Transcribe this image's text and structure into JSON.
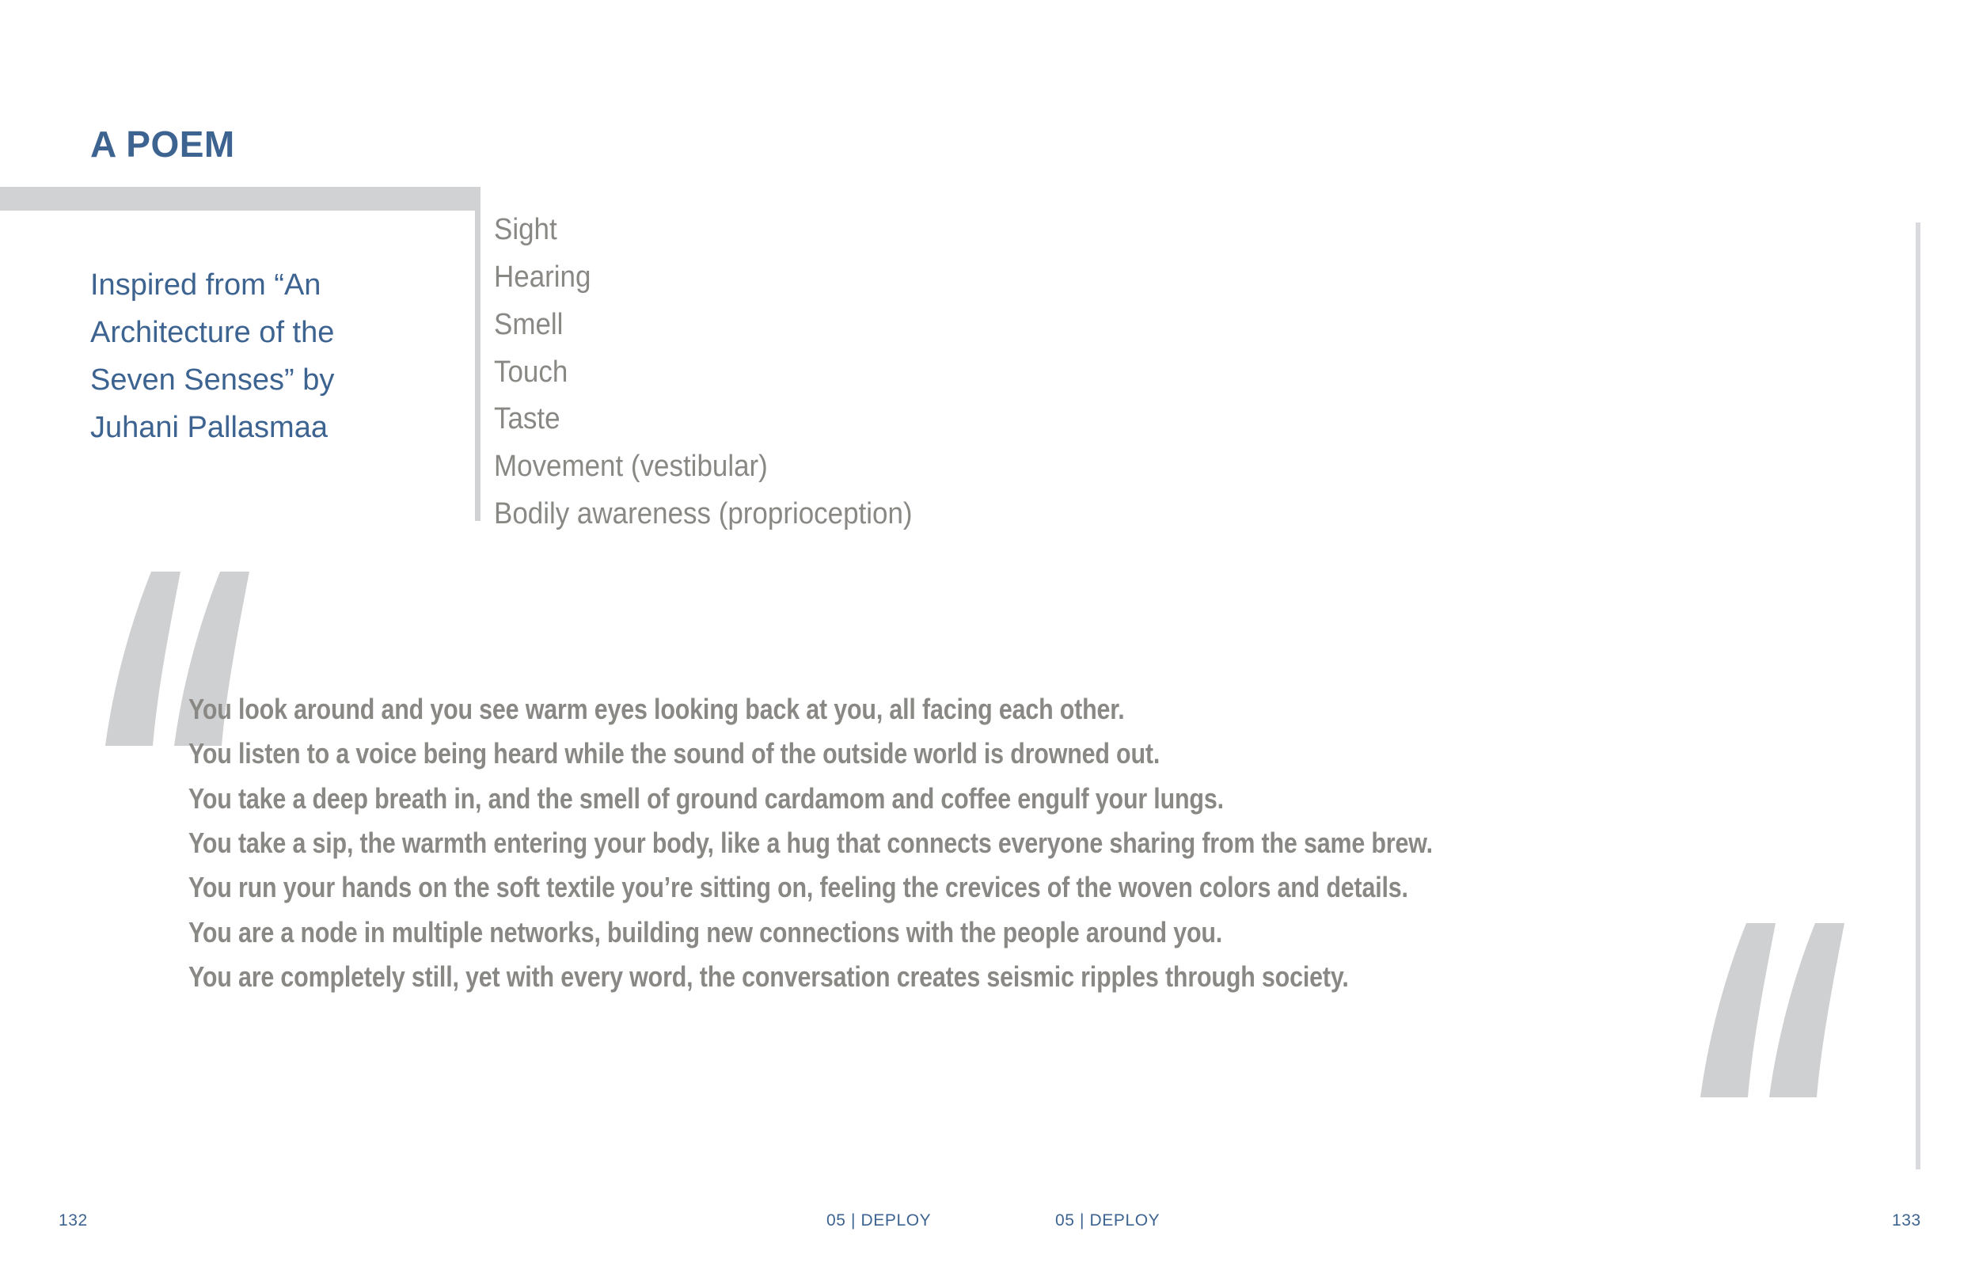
{
  "spread": {
    "title": "A POEM",
    "colors": {
      "accent_blue": "#3d6391",
      "body_grey": "#8a8884",
      "bar_grey": "#d0d2d4",
      "quote_grey": "#cfd0d2",
      "rule_grey": "#d8dade",
      "page_bg": "#ffffff"
    }
  },
  "sidebar": {
    "attribution": "Inspired from “An Architecture of the Seven Senses” by Juhani Pallasmaa"
  },
  "senses": {
    "items": [
      "Sight",
      "Hearing",
      "Smell",
      "Touch",
      "Taste",
      "Movement (vestibular)",
      "Bodily awareness (proprioception)"
    ]
  },
  "poem": {
    "open_quote_icon": "left-double-quote-icon",
    "close_quote_icon": "right-double-quote-icon",
    "lines": [
      "You look around and you see warm eyes looking back at you, all facing each other.",
      "You listen to a voice being heard while the sound of the outside world is drowned out.",
      "You take a deep breath in, and the smell of ground cardamom and coffee engulf your lungs.",
      "You take a sip, the warmth entering your body, like a hug that connects everyone  sharing from the same brew.",
      "You run your hands on the soft textile you’re sitting on, feeling the crevices of the woven colors and details.",
      "You are a node in multiple networks, building new connections with the people around you.",
      "You are completely still, yet with every word, the conversation creates seismic ripples through society."
    ]
  },
  "footer": {
    "page_left": "132",
    "section_left": "05 | DEPLOY",
    "section_right": "05 | DEPLOY",
    "page_right": "133"
  }
}
